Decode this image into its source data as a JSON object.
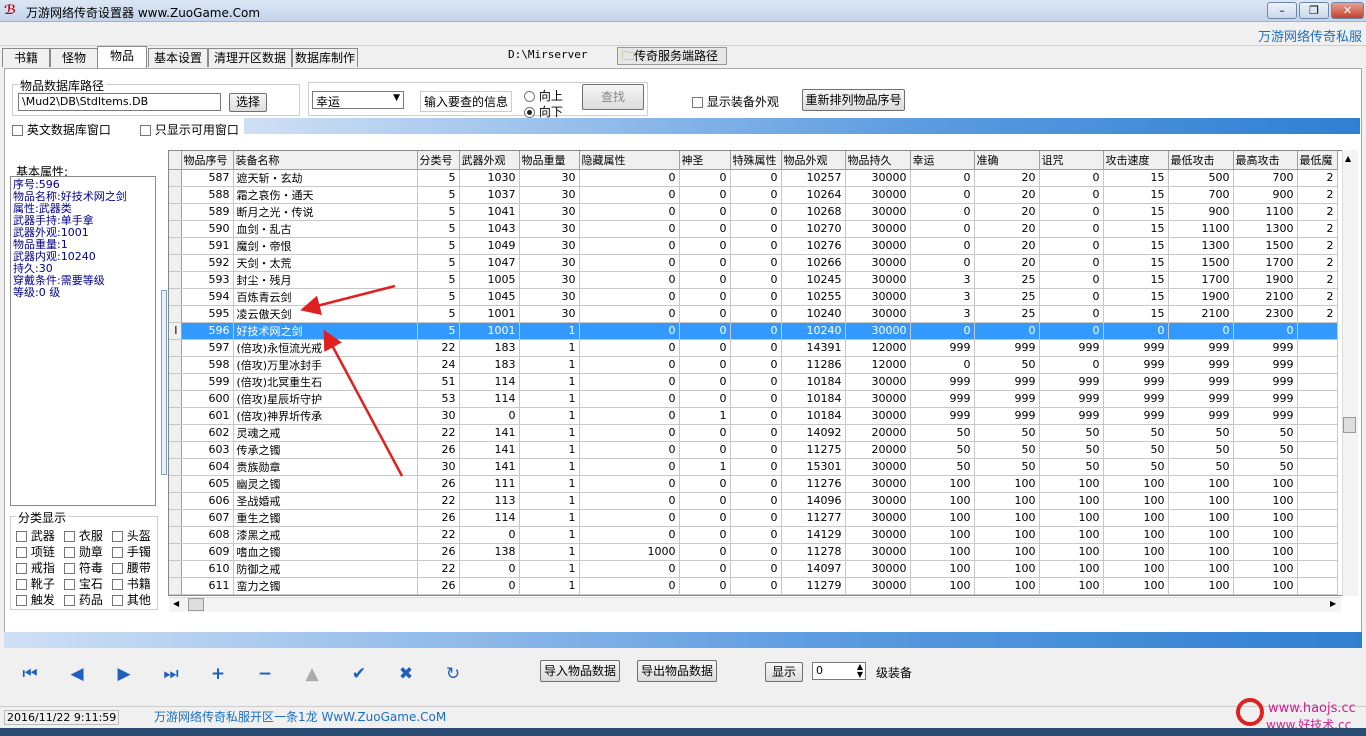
{
  "window": {
    "title": "万游网络传奇设置器 www.ZuoGame.Com",
    "brand": "万游网络传奇私服",
    "minimize_icon": "minimize-icon",
    "maximize_icon": "maximize-icon",
    "close_icon": "close-icon"
  },
  "tabs": [
    "书籍",
    "怪物",
    "物品",
    "基本设置",
    "清理开区数据",
    "数据库制作"
  ],
  "active_tab": "物品",
  "server": {
    "path": "D:\\Mirserver",
    "button_label": "传奇服务端路径"
  },
  "db": {
    "group_label": "物品数据库路径",
    "path": "\\Mud2\\DB\\StdItems.DB",
    "choose_label": "选择"
  },
  "search": {
    "field": "幸运",
    "prompt": "输入要查的信息",
    "up_label": "向上",
    "down_label": "向下",
    "find_label": "查找",
    "show_appearance_label": "显示装备外观",
    "reorder_label": "重新排列物品序号"
  },
  "options": {
    "english_window": "英文数据库窗口",
    "only_available": "只显示可用窗口"
  },
  "props": {
    "title": "基本属性:",
    "lines": [
      "序号:596",
      "物品名称:好技术网之剑",
      "属性:武器类",
      "武器手持:单手拿",
      "武器外观:1001",
      "物品重量:1",
      "武器内观:10240",
      "持久:30",
      "穿戴条件:需要等级",
      "等级:0 级"
    ]
  },
  "categories": {
    "title": "分类显示",
    "items": [
      "武器",
      "衣服",
      "头盔",
      "项链",
      "勋章",
      "手镯",
      "戒指",
      "符毒",
      "腰带",
      "靴子",
      "宝石",
      "书籍",
      "触发",
      "药品",
      "其他"
    ]
  },
  "grid": {
    "columns": [
      "物品序号",
      "装备名称",
      "分类号",
      "武器外观",
      "物品重量",
      "隐藏属性",
      "神圣",
      "特殊属性",
      "物品外观",
      "物品持久",
      "幸运",
      "准确",
      "诅咒",
      "攻击速度",
      "最低攻击",
      "最高攻击",
      "最低魔"
    ],
    "rows": [
      [
        "587",
        "遮天斩・玄劫",
        "5",
        "1030",
        "30",
        "0",
        "0",
        "0",
        "10257",
        "30000",
        "0",
        "20",
        "0",
        "15",
        "500",
        "700",
        "2"
      ],
      [
        "588",
        "霜之哀伤・通天",
        "5",
        "1037",
        "30",
        "0",
        "0",
        "0",
        "10264",
        "30000",
        "0",
        "20",
        "0",
        "15",
        "700",
        "900",
        "2"
      ],
      [
        "589",
        "断月之光・传说",
        "5",
        "1041",
        "30",
        "0",
        "0",
        "0",
        "10268",
        "30000",
        "0",
        "20",
        "0",
        "15",
        "900",
        "1100",
        "2"
      ],
      [
        "590",
        "血剑・乱古",
        "5",
        "1043",
        "30",
        "0",
        "0",
        "0",
        "10270",
        "30000",
        "0",
        "20",
        "0",
        "15",
        "1100",
        "1300",
        "2"
      ],
      [
        "591",
        "魔剑・帝恨",
        "5",
        "1049",
        "30",
        "0",
        "0",
        "0",
        "10276",
        "30000",
        "0",
        "20",
        "0",
        "15",
        "1300",
        "1500",
        "2"
      ],
      [
        "592",
        "天剑・太荒",
        "5",
        "1047",
        "30",
        "0",
        "0",
        "0",
        "10266",
        "30000",
        "0",
        "20",
        "0",
        "15",
        "1500",
        "1700",
        "2"
      ],
      [
        "593",
        "封尘・残月",
        "5",
        "1005",
        "30",
        "0",
        "0",
        "0",
        "10245",
        "30000",
        "3",
        "25",
        "0",
        "15",
        "1700",
        "1900",
        "2"
      ],
      [
        "594",
        "百炼青云剑",
        "5",
        "1045",
        "30",
        "0",
        "0",
        "0",
        "10255",
        "30000",
        "3",
        "25",
        "0",
        "15",
        "1900",
        "2100",
        "2"
      ],
      [
        "595",
        "凌云傲天剑",
        "5",
        "1001",
        "30",
        "0",
        "0",
        "0",
        "10240",
        "30000",
        "3",
        "25",
        "0",
        "15",
        "2100",
        "2300",
        "2"
      ],
      [
        "596",
        "好技术网之剑",
        "5",
        "1001",
        "1",
        "0",
        "0",
        "0",
        "10240",
        "30000",
        "0",
        "0",
        "0",
        "0",
        "0",
        "0",
        ""
      ],
      [
        "597",
        "(倍攻)永恒流光戒",
        "22",
        "183",
        "1",
        "0",
        "0",
        "0",
        "14391",
        "12000",
        "999",
        "999",
        "999",
        "999",
        "999",
        "999",
        ""
      ],
      [
        "598",
        "(倍攻)万里冰封手",
        "24",
        "183",
        "1",
        "0",
        "0",
        "0",
        "11286",
        "12000",
        "0",
        "50",
        "0",
        "999",
        "999",
        "999",
        ""
      ],
      [
        "599",
        "(倍攻)北冥重生石",
        "51",
        "114",
        "1",
        "0",
        "0",
        "0",
        "10184",
        "30000",
        "999",
        "999",
        "999",
        "999",
        "999",
        "999",
        ""
      ],
      [
        "600",
        "(倍攻)星辰圻守护",
        "53",
        "114",
        "1",
        "0",
        "0",
        "0",
        "10184",
        "30000",
        "999",
        "999",
        "999",
        "999",
        "999",
        "999",
        ""
      ],
      [
        "601",
        "(倍攻)神界圻传承",
        "30",
        "0",
        "1",
        "0",
        "1",
        "0",
        "10184",
        "30000",
        "999",
        "999",
        "999",
        "999",
        "999",
        "999",
        ""
      ],
      [
        "602",
        "灵魂之戒",
        "22",
        "141",
        "1",
        "0",
        "0",
        "0",
        "14092",
        "20000",
        "50",
        "50",
        "50",
        "50",
        "50",
        "50",
        ""
      ],
      [
        "603",
        "传承之镯",
        "26",
        "141",
        "1",
        "0",
        "0",
        "0",
        "11275",
        "20000",
        "50",
        "50",
        "50",
        "50",
        "50",
        "50",
        ""
      ],
      [
        "604",
        "贵族勋章",
        "30",
        "141",
        "1",
        "0",
        "1",
        "0",
        "15301",
        "30000",
        "50",
        "50",
        "50",
        "50",
        "50",
        "50",
        ""
      ],
      [
        "605",
        "幽灵之镯",
        "26",
        "111",
        "1",
        "0",
        "0",
        "0",
        "11276",
        "30000",
        "100",
        "100",
        "100",
        "100",
        "100",
        "100",
        ""
      ],
      [
        "606",
        "圣战婚戒",
        "22",
        "113",
        "1",
        "0",
        "0",
        "0",
        "14096",
        "30000",
        "100",
        "100",
        "100",
        "100",
        "100",
        "100",
        ""
      ],
      [
        "607",
        "重生之镯",
        "26",
        "114",
        "1",
        "0",
        "0",
        "0",
        "11277",
        "30000",
        "100",
        "100",
        "100",
        "100",
        "100",
        "100",
        ""
      ],
      [
        "608",
        "漆黑之戒",
        "22",
        "0",
        "1",
        "0",
        "0",
        "0",
        "14129",
        "30000",
        "100",
        "100",
        "100",
        "100",
        "100",
        "100",
        ""
      ],
      [
        "609",
        "嗜血之镯",
        "26",
        "138",
        "1",
        "1000",
        "0",
        "0",
        "11278",
        "30000",
        "100",
        "100",
        "100",
        "100",
        "100",
        "100",
        ""
      ],
      [
        "610",
        "防御之戒",
        "22",
        "0",
        "1",
        "0",
        "0",
        "0",
        "14097",
        "30000",
        "100",
        "100",
        "100",
        "100",
        "100",
        "100",
        ""
      ],
      [
        "611",
        "蛮力之镯",
        "26",
        "0",
        "1",
        "0",
        "0",
        "0",
        "11279",
        "30000",
        "100",
        "100",
        "100",
        "100",
        "100",
        "100",
        ""
      ]
    ],
    "selected_id": "596"
  },
  "nav": {
    "icons": [
      "first-icon",
      "prev-icon",
      "next-icon",
      "last-icon",
      "insert-icon",
      "delete-icon",
      "edit-icon",
      "post-icon",
      "cancel-icon",
      "refresh-icon"
    ],
    "import_label": "导入物品数据",
    "export_label": "导出物品数据",
    "show_label": "显示",
    "level_value": "0",
    "level_suffix": "级装备"
  },
  "status": {
    "datetime": "2016/11/22  9:11:59",
    "message": "万游网络传奇私服开区一条1龙 WwW.ZuoGame.CoM",
    "watermark1": "www.haojs.cc",
    "watermark2": "www.好技术.cc"
  },
  "colors": {
    "accent": "#3399ff",
    "brand": "#1a6fc4",
    "arrow": "#e02020",
    "props_text": "#00008b"
  }
}
